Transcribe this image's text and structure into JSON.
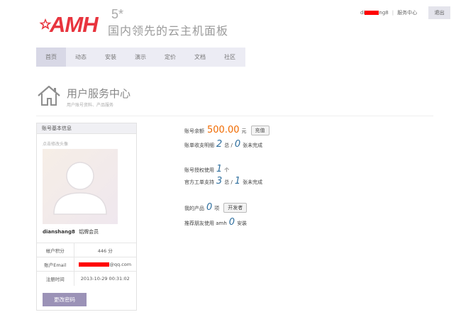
{
  "header": {
    "logo_text": "AMH",
    "version": "5*",
    "tagline": "国内领先的云主机面板",
    "user_suffix": "ng8",
    "user_prefix": "di",
    "service_center_link": "服务中心",
    "separator": "|",
    "logout_label": "退出"
  },
  "nav": {
    "items": [
      {
        "label": "首页"
      },
      {
        "label": "动态"
      },
      {
        "label": "安装"
      },
      {
        "label": "演示"
      },
      {
        "label": "定价"
      },
      {
        "label": "文档"
      },
      {
        "label": "社区"
      }
    ]
  },
  "section": {
    "title": "用户服务中心",
    "subtitle": "用户账号资料、产品服务"
  },
  "account_panel": {
    "heading": "账号基本信息",
    "avatar_hint": "点击修改头像",
    "username": "dianshang8",
    "member_level": "铝牌会员",
    "rows": [
      {
        "key": "帐户积分",
        "value": "446 分"
      },
      {
        "key": "账户Email",
        "value": "@qq.com"
      },
      {
        "key": "注册时间",
        "value": "2013-10-29 00:31:02"
      }
    ],
    "change_password_label": "更改密码"
  },
  "stats": {
    "balance_label": "账号余额",
    "balance_value": "500.00",
    "balance_unit": "元",
    "recharge_label": "充值",
    "bill_label": "账单收支明细",
    "bill_total": "2",
    "bill_total_unit": "总 /",
    "bill_pending": "0",
    "bill_pending_unit": "张未完成",
    "license_label": "账号授权使用",
    "license_count": "1",
    "license_unit": "个",
    "ticket_label": "官方工单支持",
    "ticket_total": "3",
    "ticket_total_unit": "总 /",
    "ticket_pending": "1",
    "ticket_pending_unit": "张未完成",
    "products_label": "我的产品",
    "products_count": "0",
    "products_unit": "项",
    "developer_label": "开发者",
    "referral_label": "推荐朋友使用 amh",
    "referral_count": "0",
    "referral_unit": "安装"
  },
  "colors": {
    "brand_red": "#e8343e",
    "accent_blue": "#2f6f9e",
    "money_orange": "#f06a00",
    "button_purple": "#9b92b7",
    "nav_bg": "#ececf4"
  }
}
